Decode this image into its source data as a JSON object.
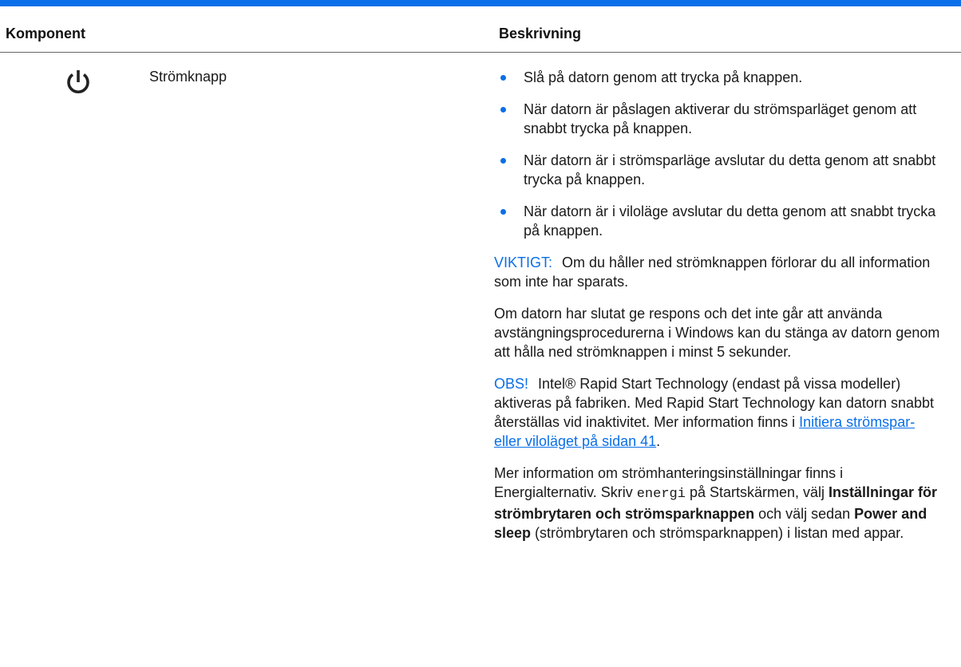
{
  "header": {
    "component_label": "Komponent",
    "description_label": "Beskrivning"
  },
  "row": {
    "icon": "power-icon",
    "component_name": "Strömknapp",
    "bullets": [
      "Slå på datorn genom att trycka på knappen.",
      "När datorn är påslagen aktiverar du strömsparläget genom att snabbt trycka på knappen.",
      "När datorn är i strömsparläge avslutar du detta genom att snabbt trycka på knappen.",
      "När datorn är i viloläge avslutar du detta genom att snabbt trycka på knappen."
    ],
    "important": {
      "label": "VIKTIGT:",
      "text": "Om du håller ned strömknappen förlorar du all information som inte har sparats."
    },
    "unresponsive_text": "Om datorn har slutat ge respons och det inte går att använda avstängningsprocedurerna i Windows kan du stänga av datorn genom att hålla ned strömknappen i minst 5 sekunder.",
    "note": {
      "label": "OBS!",
      "text_before_link": "Intel® Rapid Start Technology (endast på vissa modeller) aktiveras på fabriken. Med Rapid Start Technology kan datorn snabbt återställas vid inaktivitet. Mer information finns i ",
      "link_text": "Initiera strömspar- eller viloläget på sidan 41",
      "text_after_link": "."
    },
    "more_info": {
      "part1": "Mer information om strömhanteringsinställningar finns i Energialternativ. Skriv ",
      "code": "energi",
      "part2": " på Startskärmen, välj ",
      "bold1": "Inställningar för strömbrytaren och strömsparknappen",
      "part3": " och välj sedan ",
      "bold2": "Power and sleep",
      "part4": " (strömbrytaren och strömsparknappen) i listan med appar."
    }
  },
  "colors": {
    "accent": "#0a6fe8"
  }
}
